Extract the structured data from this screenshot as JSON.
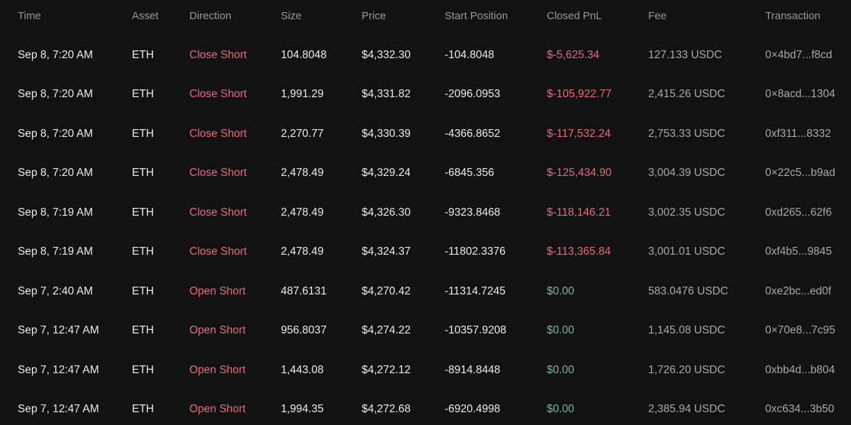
{
  "headers": {
    "time": "Time",
    "asset": "Asset",
    "direction": "Direction",
    "size": "Size",
    "price": "Price",
    "start_position": "Start Position",
    "closed_pnl": "Closed PnL",
    "fee": "Fee",
    "transaction": "Transaction"
  },
  "rows": [
    {
      "time": "Sep 8, 7:20 AM",
      "asset": "ETH",
      "direction": "Close Short",
      "size": "104.8048",
      "price": "$4,332.30",
      "start_position": "-104.8048",
      "closed_pnl": "$-5,625.34",
      "fee": "127.133 USDC",
      "transaction": "0×4bd7...f8cd"
    },
    {
      "time": "Sep 8, 7:20 AM",
      "asset": "ETH",
      "direction": "Close Short",
      "size": "1,991.29",
      "price": "$4,331.82",
      "start_position": "-2096.0953",
      "closed_pnl": "$-105,922.77",
      "fee": "2,415.26 USDC",
      "transaction": "0×8acd...1304"
    },
    {
      "time": "Sep 8, 7:20 AM",
      "asset": "ETH",
      "direction": "Close Short",
      "size": "2,270.77",
      "price": "$4,330.39",
      "start_position": "-4366.8652",
      "closed_pnl": "$-117,532.24",
      "fee": "2,753.33 USDC",
      "transaction": "0xf311...8332"
    },
    {
      "time": "Sep 8, 7:20 AM",
      "asset": "ETH",
      "direction": "Close Short",
      "size": "2,478.49",
      "price": "$4,329.24",
      "start_position": "-6845.356",
      "closed_pnl": "$-125,434.90",
      "fee": "3,004.39 USDC",
      "transaction": "0×22c5...b9ad"
    },
    {
      "time": "Sep 8, 7:19 AM",
      "asset": "ETH",
      "direction": "Close Short",
      "size": "2,478.49",
      "price": "$4,326.30",
      "start_position": "-9323.8468",
      "closed_pnl": "$-118,146.21",
      "fee": "3,002.35 USDC",
      "transaction": "0xd265...62f6"
    },
    {
      "time": "Sep 8, 7:19 AM",
      "asset": "ETH",
      "direction": "Close Short",
      "size": "2,478.49",
      "price": "$4,324.37",
      "start_position": "-11802.3376",
      "closed_pnl": "$-113,365.84",
      "fee": "3,001.01 USDC",
      "transaction": "0xf4b5...9845"
    },
    {
      "time": "Sep 7, 2:40 AM",
      "asset": "ETH",
      "direction": "Open Short",
      "size": "487.6131",
      "price": "$4,270.42",
      "start_position": "-11314.7245",
      "closed_pnl": "$0.00",
      "fee": "583.0476 USDC",
      "transaction": "0xe2bc...ed0f"
    },
    {
      "time": "Sep 7, 12:47 AM",
      "asset": "ETH",
      "direction": "Open Short",
      "size": "956.8037",
      "price": "$4,274.22",
      "start_position": "-10357.9208",
      "closed_pnl": "$0.00",
      "fee": "1,145.08 USDC",
      "transaction": "0×70e8...7c95"
    },
    {
      "time": "Sep 7, 12:47 AM",
      "asset": "ETH",
      "direction": "Open Short",
      "size": "1,443.08",
      "price": "$4,272.12",
      "start_position": "-8914.8448",
      "closed_pnl": "$0.00",
      "fee": "1,726.20 USDC",
      "transaction": "0xbb4d...b804"
    },
    {
      "time": "Sep 7, 12:47 AM",
      "asset": "ETH",
      "direction": "Open Short",
      "size": "1,994.35",
      "price": "$4,272.68",
      "start_position": "-6920.4998",
      "closed_pnl": "$0.00",
      "fee": "2,385.94 USDC",
      "transaction": "0xc634...3b50"
    }
  ],
  "colors": {
    "background": "#121212",
    "header_text": "#9a9a9a",
    "direction_short": "#e26d7e",
    "pnl_negative": "#e26d7e",
    "pnl_zero": "#74b596"
  }
}
